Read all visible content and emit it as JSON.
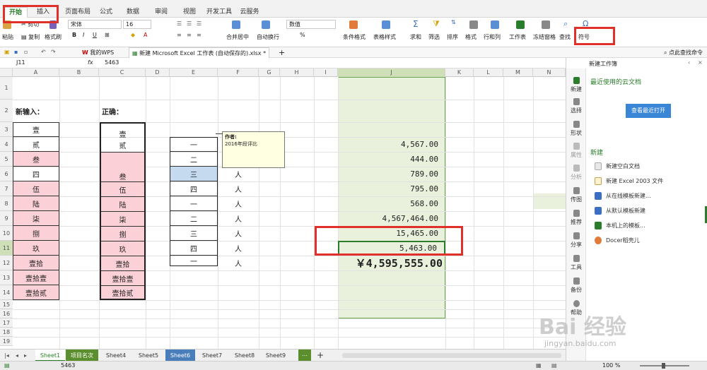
{
  "ribbon_tabs": [
    "开始",
    "插入",
    "页面布局",
    "公式",
    "数据",
    "审阅",
    "视图",
    "开发工具",
    "云服务"
  ],
  "toolbar": {
    "paste": "粘贴",
    "cut": "剪切",
    "copy": "复制",
    "format_painter": "格式刷",
    "font": "宋体",
    "font_size": "16",
    "number_format": "数值",
    "merge_center": "合并居中",
    "wrap_text": "自动换行",
    "cond_format": "条件格式",
    "table_style": "表格样式",
    "sum": "求和",
    "filter": "筛选",
    "sort": "排序",
    "format": "格式",
    "row_col": "行和列",
    "worksheet": "工作表",
    "freeze": "冻结窗格",
    "find": "查找",
    "symbol": "符号",
    "bold": "B",
    "italic": "I",
    "underline": "U",
    "percent": "%"
  },
  "doc_tabs": {
    "wps": "我的WPS",
    "file": "新建 Microsoft Excel 工作表 (自动保存的).xlsx *",
    "add": "+",
    "search": "点此查找命令"
  },
  "formula_bar": {
    "name_box": "J11",
    "fx": "fx",
    "value": "5463"
  },
  "columns": [
    "A",
    "B",
    "C",
    "D",
    "E",
    "F",
    "G",
    "H",
    "I",
    "J",
    "K",
    "L",
    "M",
    "N"
  ],
  "rows": [
    "1",
    "2",
    "3",
    "4",
    "5",
    "6",
    "7",
    "8",
    "9",
    "10",
    "11",
    "12",
    "13",
    "14",
    "15",
    "16",
    "17",
    "18",
    "19"
  ],
  "cells": {
    "a2": "新输入：",
    "c2": "正确：",
    "a": [
      "壹",
      "贰",
      "叁",
      "四",
      "伍",
      "陆",
      "柒",
      "捌",
      "玖",
      "壹拾",
      "壹拾壹",
      "壹拾贰"
    ],
    "c_top": "壹",
    "c_top2": "贰",
    "c": [
      "叁",
      "伍",
      "陆",
      "柒",
      "捌",
      "玖",
      "壹拾",
      "壹拾壹",
      "壹拾贰"
    ],
    "e": [
      "一",
      "二",
      "三",
      "四",
      "一",
      "二",
      "三",
      "四",
      "一"
    ],
    "f": [
      "人",
      "人",
      "人",
      "人",
      "人",
      "人",
      "人"
    ],
    "j": [
      "4,567.00",
      "444.00",
      "789.00",
      "795.00",
      "568.00",
      "4,567,464.00",
      "15,465.00",
      "5,463.00"
    ],
    "j_total": "￥4,595,555.00"
  },
  "comment": {
    "author": "作者:",
    "text": "2016年段评比"
  },
  "sheets": [
    "Sheet1",
    "项目名次",
    "Sheet4",
    "Sheet5",
    "Sheet6",
    "Sheet7",
    "Sheet8",
    "Sheet9"
  ],
  "status": {
    "value": "5463",
    "zoom": "100 %"
  },
  "pane": {
    "title": "新建工作簿",
    "recent": "最近使用的云文档",
    "open_btn": "查看最近打开",
    "new_header": "新建",
    "items": [
      "新建空白文档",
      "新建 Excel 2003 文件",
      "从在线模板新建...",
      "从默认模板新建",
      "本机上的模板...",
      "Docer稻壳儿"
    ],
    "vtabs": [
      "新建",
      "选择",
      "形状",
      "属性",
      "分析",
      "传图",
      "推荐",
      "分享",
      "工具",
      "备份",
      "帮助"
    ]
  },
  "watermark": {
    "brand": "Bai 经验",
    "url": "jingyan.baidu.com"
  },
  "colors": {
    "accent": "#2a7d2a",
    "pink": "#fbd0d6",
    "selection": "#e9f0dc",
    "red": "#e0302a"
  }
}
